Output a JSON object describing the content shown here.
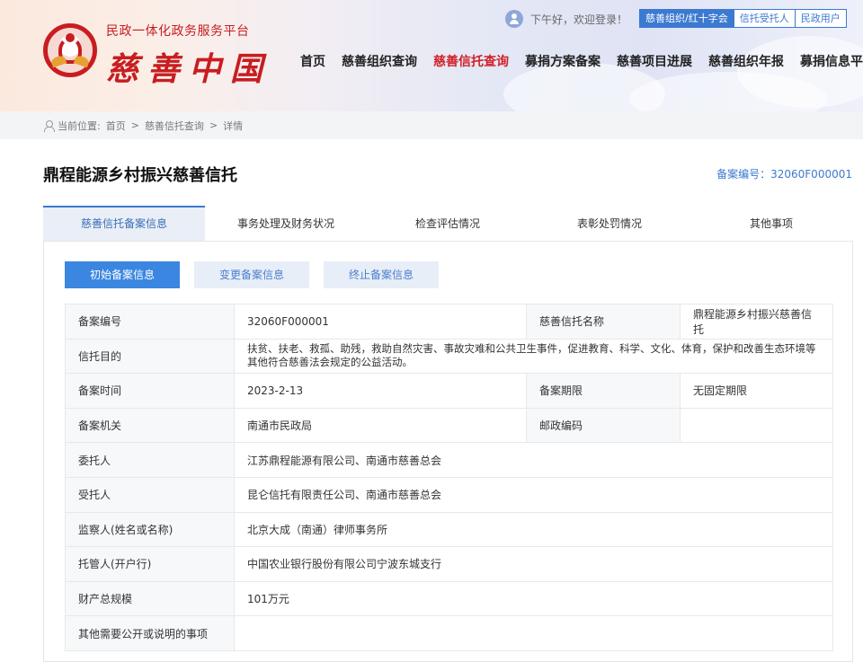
{
  "header": {
    "logo_top": "民政一体化政务服务平台",
    "logo_main": "慈善中国",
    "greeting": "下午好，欢迎登录！",
    "roles": [
      "慈善组织/红十字会",
      "信托受托人",
      "民政用户"
    ],
    "nav": [
      "首页",
      "慈善组织查询",
      "慈善信托查询",
      "募捐方案备案",
      "慈善项目进展",
      "慈善组织年报",
      "募捐信息平台"
    ],
    "active_nav": "慈善信托查询"
  },
  "breadcrumb": {
    "prefix": "当前位置:",
    "items": [
      "首页",
      "慈善信托查询",
      "详情"
    ]
  },
  "page": {
    "title": "鼎程能源乡村振兴慈善信托",
    "record_no_text": "备案编号：32060F000001"
  },
  "main_tabs": [
    "慈善信托备案信息",
    "事务处理及财务状况",
    "检查评估情况",
    "表彰处罚情况",
    "其他事项"
  ],
  "sub_tabs": [
    "初始备案信息",
    "变更备案信息",
    "终止备案信息"
  ],
  "table": {
    "record_no_label": "备案编号",
    "record_no_value": "32060F000001",
    "trust_name_label": "慈善信托名称",
    "trust_name_value": "鼎程能源乡村振兴慈善信托",
    "purpose_label": "信托目的",
    "purpose_value": "扶贫、扶老、救孤、助残，救助自然灾害、事故灾难和公共卫生事件，促进教育、科学、文化、体育，保护和改善生态环境等其他符合慈善法会规定的公益活动。",
    "record_time_label": "备案时间",
    "record_time_value": "2023-2-13",
    "record_period_label": "备案期限",
    "record_period_value": "无固定期限",
    "record_org_label": "备案机关",
    "record_org_value": "南通市民政局",
    "postcode_label": "邮政编码",
    "postcode_value": "",
    "settlor_label": "委托人",
    "settlor_value": "江苏鼎程能源有限公司、南通市慈善总会",
    "trustee_label": "受托人",
    "trustee_value": "昆仑信托有限责任公司、南通市慈善总会",
    "supervisor_label": "监察人(姓名或名称)",
    "supervisor_value": "北京大成（南通）律师事务所",
    "custodian_label": "托管人(开户行)",
    "custodian_value": "中国农业银行股份有限公司宁波东城支行",
    "assets_label": "财产总规模",
    "assets_value": "101万元",
    "other_label": "其他需要公开或说明的事项",
    "other_value": ""
  },
  "colors": {
    "brand_red": "#c81d20",
    "accent_blue": "#3b7ad0",
    "active_nav": "#d0202a"
  }
}
